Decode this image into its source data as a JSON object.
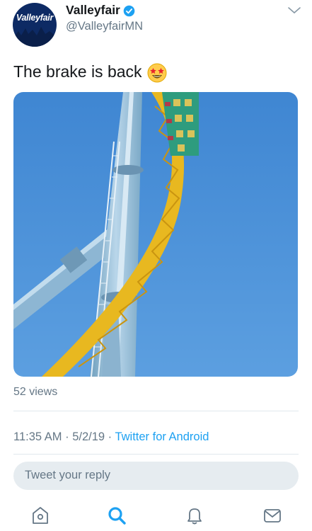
{
  "header": {
    "avatar_text": "Valleyfair",
    "display_name": "Valleyfair",
    "handle": "@ValleyfairMN"
  },
  "tweet": {
    "text": "The brake is back",
    "emoji": "star-struck-emoji"
  },
  "media": {
    "views": "52 views"
  },
  "meta": {
    "time": "11:35 AM",
    "date": "5/2/19",
    "separator": "·",
    "source": "Twitter for Android"
  },
  "reply": {
    "placeholder": "Tweet your reply"
  },
  "tabs": [
    "home-icon",
    "search-icon",
    "notifications-icon",
    "messages-icon"
  ],
  "colors": {
    "accent": "#1da1f2",
    "secondary_text": "#657786",
    "sky": "#4a8fd6",
    "track": "#e8b820"
  }
}
